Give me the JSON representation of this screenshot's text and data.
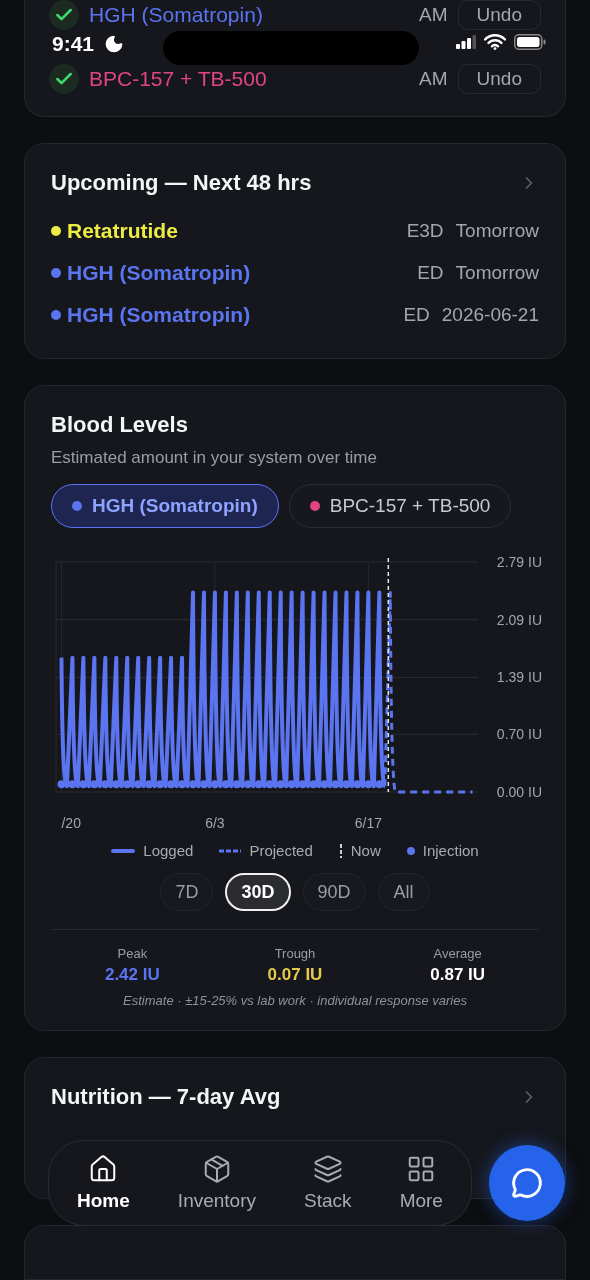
{
  "status_bar": {
    "time": "9:41"
  },
  "logged_today": [
    {
      "name": "HGH (Somatropin)",
      "color": "#5b74f0",
      "time": "AM",
      "action": "Undo"
    },
    {
      "name": "BPC-157 + TB-500",
      "color": "#e0457f",
      "time": "AM",
      "action": "Undo"
    }
  ],
  "upcoming": {
    "title": "Upcoming — Next 48 hrs",
    "items": [
      {
        "name": "Retatrutide",
        "color": "#ecec45",
        "frequency": "E3D",
        "when": "Tomorrow"
      },
      {
        "name": "HGH (Somatropin)",
        "color": "#5b74f0",
        "frequency": "ED",
        "when": "Tomorrow"
      },
      {
        "name": "HGH (Somatropin)",
        "color": "#5b74f0",
        "frequency": "ED",
        "when": "2026-06-21"
      }
    ]
  },
  "blood_levels": {
    "title": "Blood Levels",
    "subtitle": "Estimated amount in your system over time",
    "compounds": [
      {
        "name": "HGH (Somatropin)",
        "color": "#5b74f0",
        "selected": true
      },
      {
        "name": "BPC-157 + TB-500",
        "color": "#e0457f",
        "selected": false
      }
    ],
    "chart_data": {
      "type": "line",
      "categories": [
        "/20",
        null,
        null,
        null,
        null,
        null,
        null,
        null,
        null,
        null,
        null,
        null,
        null,
        null,
        null,
        null,
        null,
        null,
        null,
        null,
        null,
        null,
        null,
        null,
        null,
        null,
        null,
        null,
        "6/3",
        null,
        null,
        null,
        null,
        null,
        null,
        null,
        null,
        null,
        null,
        null,
        null,
        null,
        null,
        null,
        null,
        null,
        null,
        null,
        null,
        null,
        null,
        null,
        null,
        null,
        null,
        null,
        "6/17",
        null,
        null,
        null,
        null,
        null,
        null,
        null,
        null,
        null,
        null,
        null,
        null,
        null,
        null,
        null,
        null,
        null,
        null,
        null
      ],
      "series": [
        {
          "name": "Logged",
          "color": "#5b74f0",
          "line_style": "solid",
          "values": [
            1.63,
            0.07,
            1.63,
            0.07,
            1.63,
            0.07,
            1.63,
            0.07,
            1.63,
            0.07,
            1.63,
            0.07,
            1.63,
            0.07,
            1.63,
            0.07,
            1.63,
            0.07,
            1.63,
            0.07,
            1.63,
            0.07,
            1.63,
            0.07,
            2.42,
            0.07,
            2.42,
            0.07,
            2.42,
            0.07,
            2.42,
            0.07,
            2.42,
            0.07,
            2.42,
            0.07,
            2.42,
            0.07,
            2.42,
            0.07,
            2.42,
            0.07,
            2.42,
            0.07,
            2.42,
            0.07,
            2.42,
            0.07,
            2.42,
            0.07,
            2.42,
            0.07,
            2.42,
            0.07,
            2.42,
            0.07,
            2.42,
            0.07,
            2.42,
            0.07,
            null,
            null,
            null,
            null,
            null,
            null,
            null,
            null,
            null,
            null,
            null,
            null,
            null,
            null,
            null,
            null
          ]
        },
        {
          "name": "Projected",
          "color": "#5b74f0",
          "line_style": "dashed",
          "values": [
            null,
            null,
            null,
            null,
            null,
            null,
            null,
            null,
            null,
            null,
            null,
            null,
            null,
            null,
            null,
            null,
            null,
            null,
            null,
            null,
            null,
            null,
            null,
            null,
            null,
            null,
            null,
            null,
            null,
            null,
            null,
            null,
            null,
            null,
            null,
            null,
            null,
            null,
            null,
            null,
            null,
            null,
            null,
            null,
            null,
            null,
            null,
            null,
            null,
            null,
            null,
            null,
            null,
            null,
            null,
            null,
            null,
            null,
            null,
            0.07,
            2.42,
            0.0,
            0.0,
            0.0,
            0.0,
            0.0,
            0.0,
            0.0,
            0.0,
            0.0,
            0.0,
            0.0,
            0.0,
            0.0,
            0.0,
            0.0
          ]
        }
      ],
      "ylim": [
        0,
        2.79
      ],
      "grid": true,
      "yticks": [
        {
          "value": 0,
          "label": "0.00 IU"
        },
        {
          "value": 0.7,
          "label": "0.70 IU"
        },
        {
          "value": 1.39,
          "label": "1.39 IU"
        },
        {
          "value": 2.09,
          "label": "2.09 IU"
        },
        {
          "value": 2.79,
          "label": "2.79 IU"
        }
      ]
    },
    "legend": [
      {
        "kind": "now",
        "label": "Now"
      },
      {
        "kind": "dot",
        "label": "Injection"
      }
    ],
    "ranges": [
      {
        "label": "7D",
        "selected": false
      },
      {
        "label": "30D",
        "selected": true
      },
      {
        "label": "90D",
        "selected": false
      },
      {
        "label": "All",
        "selected": false
      }
    ],
    "stats": [
      {
        "label": "Peak",
        "value": "2.42 IU",
        "color": "#5b74f0"
      },
      {
        "label": "Trough",
        "value": "0.07 IU",
        "color": "#e6c94a"
      },
      {
        "label": "Average",
        "value": "0.87 IU",
        "color": "#ffffff"
      }
    ],
    "footnote": "Estimate · ±15-25% vs lab work · individual response varies"
  },
  "nutrition": {
    "title": "Nutrition — 7-day Avg"
  },
  "tabs": [
    {
      "label": "Home",
      "selected": true
    },
    {
      "label": "Inventory",
      "selected": false
    },
    {
      "label": "Stack",
      "selected": false
    },
    {
      "label": "More",
      "selected": false
    }
  ]
}
